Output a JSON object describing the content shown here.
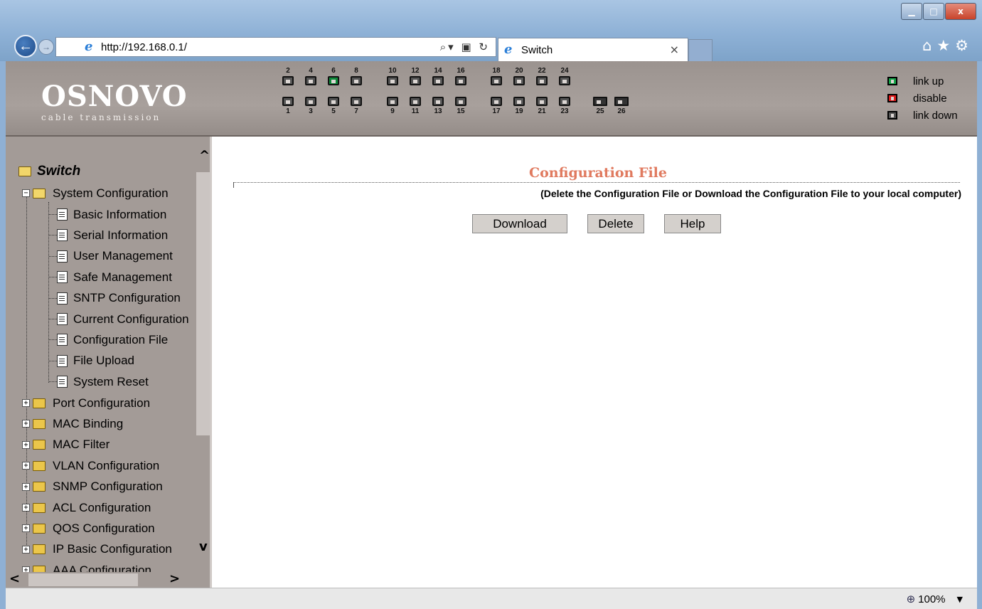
{
  "browser": {
    "url": "http://192.168.0.1/",
    "tab_title": "Switch",
    "tab_close": "×",
    "zoom": "100%"
  },
  "header": {
    "logo_name": "OSNOVO",
    "logo_sub": "cable transmission",
    "ports_top": [
      "2",
      "4",
      "6",
      "8",
      "10",
      "12",
      "14",
      "16",
      "18",
      "20",
      "22",
      "24"
    ],
    "ports_bottom": [
      "1",
      "3",
      "5",
      "7",
      "9",
      "11",
      "13",
      "15",
      "17",
      "19",
      "21",
      "23",
      "25",
      "26"
    ],
    "port_up": "6",
    "legend": {
      "link_up": "link up",
      "disable": "disable",
      "link_down": "link down",
      "colors": {
        "link_up": "#16a74a",
        "disable": "#e11b1b",
        "link_down": "#555555"
      }
    }
  },
  "tree": {
    "root": "Switch",
    "system_configuration": "System Configuration",
    "children": [
      "Basic Information",
      "Serial Information",
      "User Management",
      "Safe Management",
      "SNTP Configuration",
      "Current Configuration",
      "Configuration File",
      "File Upload",
      "System Reset"
    ],
    "collapsed": [
      "Port Configuration",
      "MAC Binding",
      "MAC Filter",
      "VLAN Configuration",
      "SNMP Configuration",
      "ACL Configuration",
      "QOS Configuration",
      "IP Basic Configuration",
      "AAA Configuration"
    ]
  },
  "main": {
    "title": "Configuration File",
    "description": "(Delete the Configuration File or Download the Configuration File to your local computer)",
    "buttons": {
      "download": "Download",
      "delete": "Delete",
      "help": "Help"
    },
    "title_color": "#e07a5f"
  }
}
